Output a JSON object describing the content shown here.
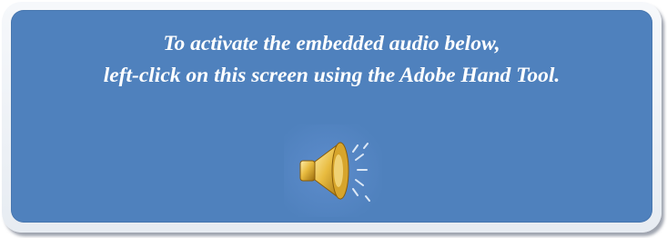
{
  "message": {
    "line1": "To activate the embedded audio below,",
    "line2": "left-click on this screen using the Adobe Hand Tool."
  },
  "audio_button": {
    "icon": "speaker-icon"
  },
  "colors": {
    "panel": "#4f81bd",
    "frame": "#eef2f7",
    "text": "#ffffff",
    "speaker": "#e2b23a"
  }
}
